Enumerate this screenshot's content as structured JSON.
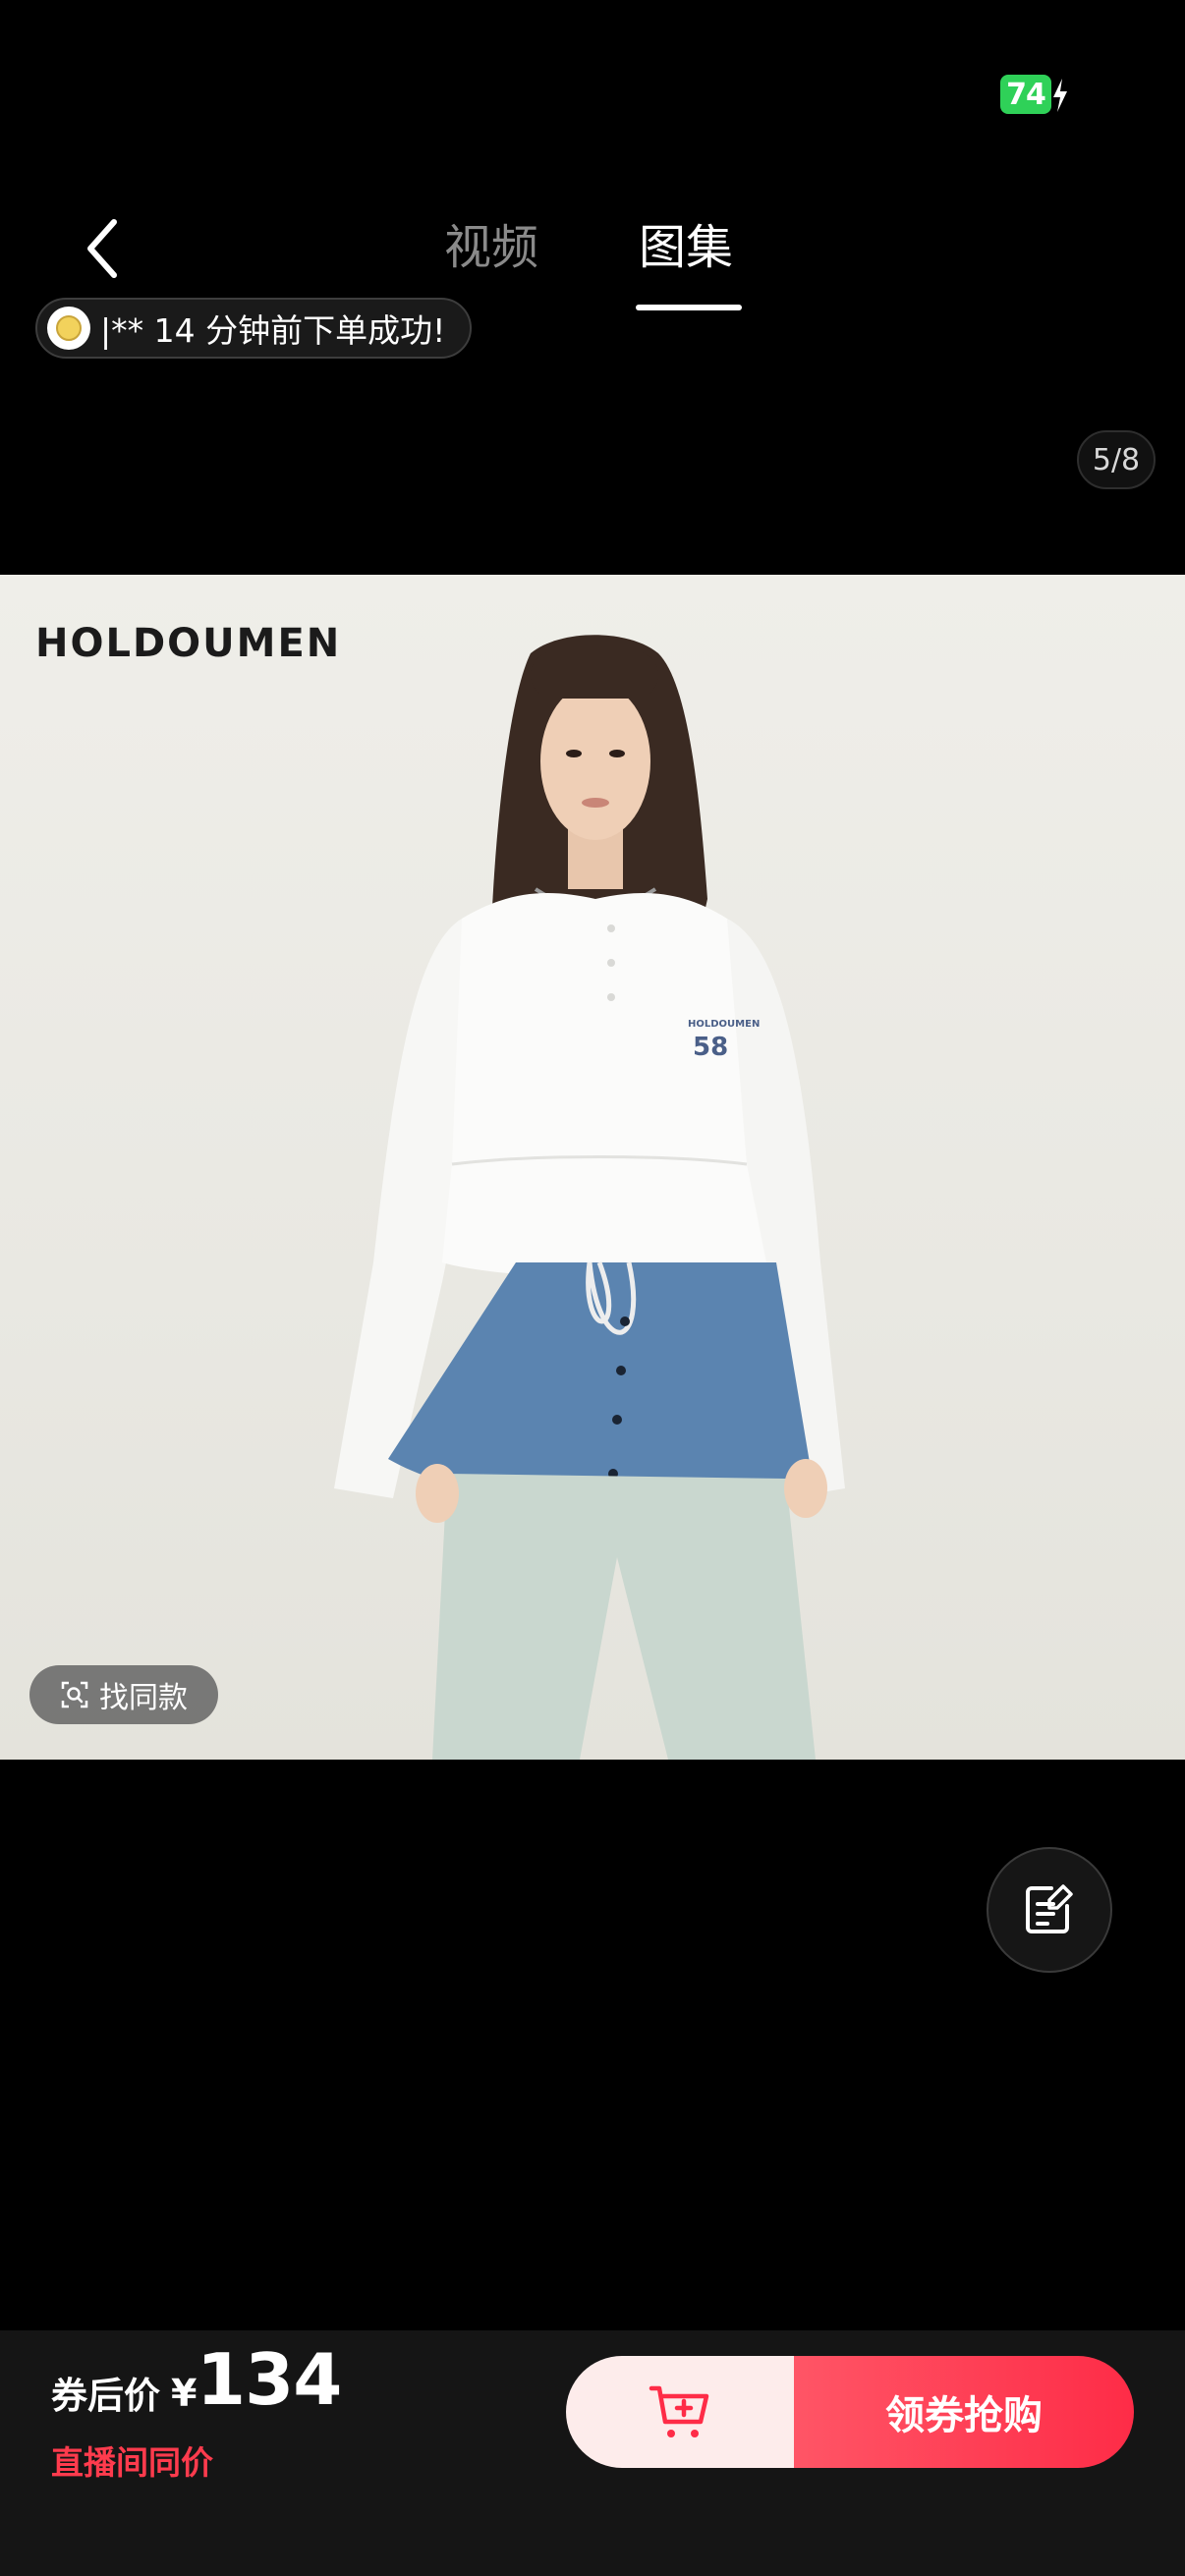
{
  "status_bar": {
    "battery": "74"
  },
  "header": {
    "tabs": [
      {
        "label": "视频",
        "active": false
      },
      {
        "label": "图集",
        "active": true
      }
    ]
  },
  "ticker": {
    "text": "|** 14 分钟前下单成功!"
  },
  "gallery": {
    "counter": "5/8",
    "brand_logo": "HOLDOUMEN",
    "shirt_print": "HOLDOUMEN 58"
  },
  "find_same": {
    "label": "找同款"
  },
  "bottom_bar": {
    "price_label": "券后价",
    "currency": "¥",
    "price": "134",
    "live_label": "直播间同价",
    "buy_label": "领券抢购"
  },
  "colors": {
    "accent": "#fe2c47",
    "battery": "#2fd158",
    "live_label": "#ff3b4d"
  },
  "icons": [
    "back-chevron-icon",
    "bolt-icon",
    "scan-search-icon",
    "note-edit-icon",
    "cart-add-icon"
  ]
}
